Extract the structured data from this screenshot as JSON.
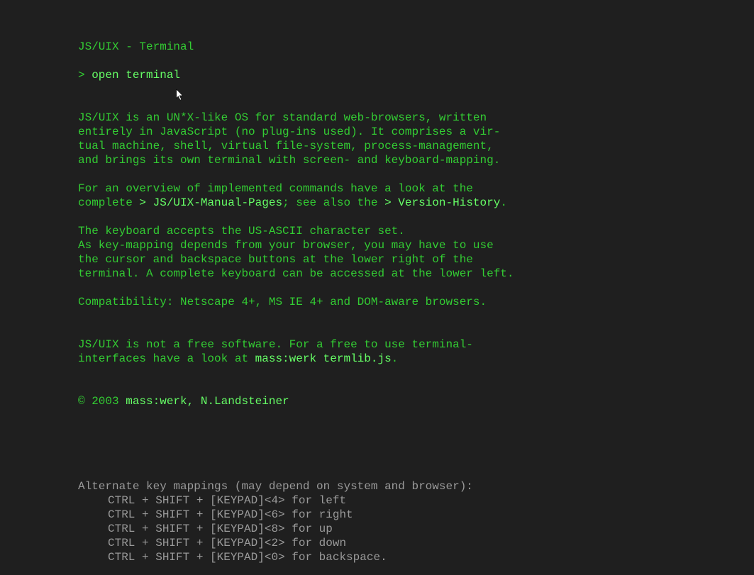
{
  "title": "JS/UIX - Terminal",
  "open_prefix": "> ",
  "open_link": "open terminal",
  "intro": {
    "l1": "JS/UIX is an UN*X-like OS for standard web-browsers, written",
    "l2": "entirely in JavaScript (no plug-ins used). It comprises a vir-",
    "l3": "tual machine, shell, virtual file-system, process-management,",
    "l4": "and brings its own terminal with screen- and keyboard-mapping."
  },
  "overview": {
    "pre1": "For an overview of implemented commands have a look at the",
    "pre2": "complete ",
    "gt1": "> ",
    "link1": "JS/UIX-Manual-Pages",
    "sep": "; see also the ",
    "gt2": "> ",
    "link2": "Version-History",
    "end": "."
  },
  "keyboard": {
    "l1": "The keyboard accepts the US-ASCII character set.",
    "l2": "As key-mapping depends from your browser, you may have to use",
    "l3": "the cursor and backspace buttons at the lower right of the",
    "l4": "terminal. A complete keyboard can be accessed at the lower left."
  },
  "compat": "Compatibility: Netscape 4+, MS IE 4+ and DOM-aware browsers.",
  "nonfree": {
    "l1": "JS/UIX is not a free software. For a free to use terminal-",
    "l2a": "interfaces have a look at ",
    "l2link": "mass:werk termlib.js",
    "l2end": "."
  },
  "copyright": {
    "pre": "© 2003 ",
    "link": "mass:werk, N.Landsteiner"
  },
  "mappings": {
    "head": "Alternate key mappings (may depend on system and browser):",
    "rows": [
      "CTRL + SHIFT + [KEYPAD]<4> for left",
      "CTRL + SHIFT + [KEYPAD]<6> for right",
      "CTRL + SHIFT + [KEYPAD]<8> for up",
      "CTRL + SHIFT + [KEYPAD]<2> for down",
      "CTRL + SHIFT + [KEYPAD]<0> for backspace."
    ]
  }
}
